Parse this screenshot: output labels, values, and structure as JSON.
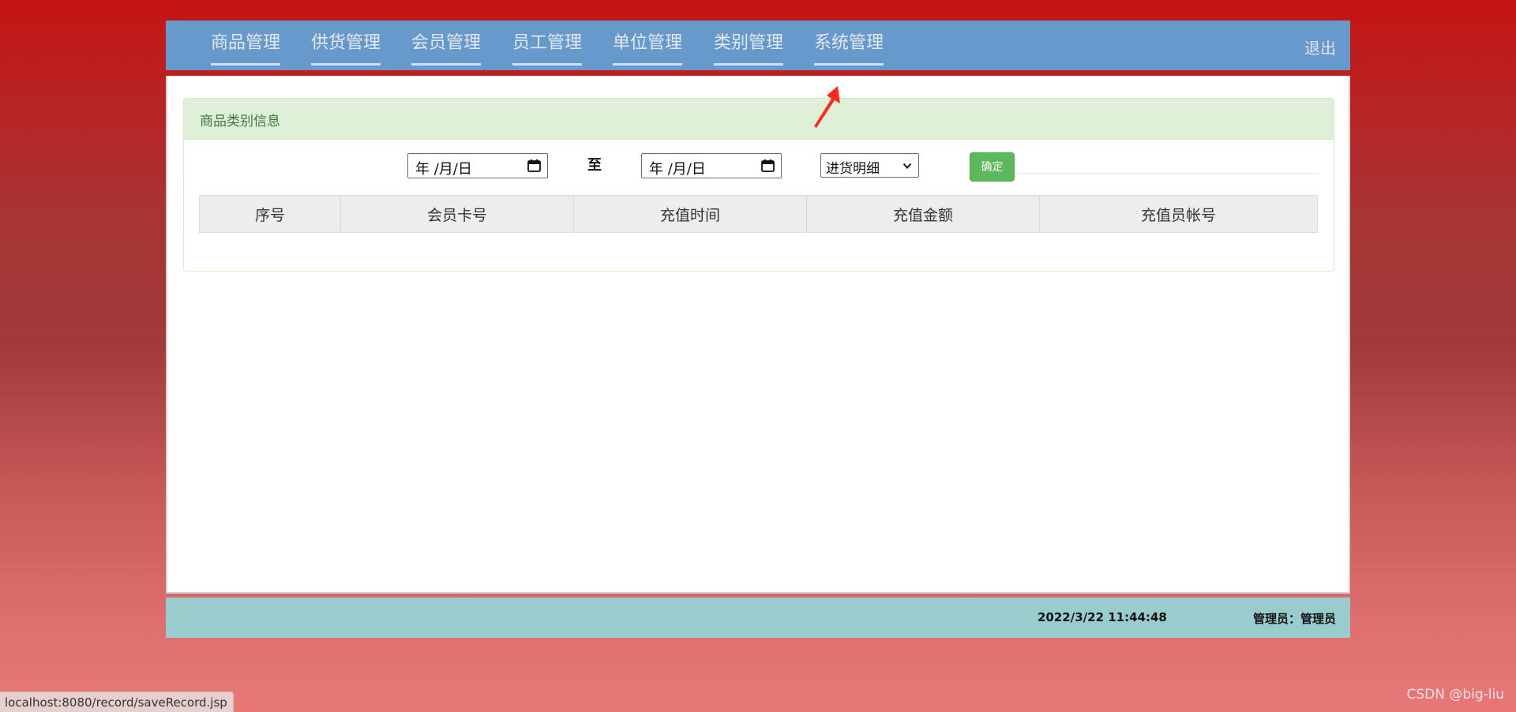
{
  "nav": {
    "items": [
      {
        "label": "商品管理"
      },
      {
        "label": "供货管理"
      },
      {
        "label": "会员管理"
      },
      {
        "label": "员工管理"
      },
      {
        "label": "单位管理"
      },
      {
        "label": "类别管理"
      },
      {
        "label": "系统管理"
      }
    ],
    "logout": "退出"
  },
  "panel": {
    "title": "商品类别信息"
  },
  "filters": {
    "start_date": "年 /月/日",
    "to_label": "至",
    "end_date": "年 /月/日",
    "select_value": "进货明细",
    "confirm_label": "确定"
  },
  "table": {
    "headers": [
      "序号",
      "会员卡号",
      "充值时间",
      "充值金额",
      "充值员帐号"
    ]
  },
  "footer": {
    "datetime": "2022/3/22 11:44:48",
    "user": "管理员：管理员"
  },
  "statusbar": {
    "url": "localhost:8080/record/saveRecord.jsp"
  },
  "watermark": {
    "text": "CSDN @big-liu"
  },
  "colors": {
    "nav_bg": "#6699cc",
    "panel_heading_bg": "#dff0d8",
    "confirm_bg": "#5cb85c",
    "footer_bg": "#99cccc",
    "page_bg_top": "#c61414",
    "page_bg_bottom": "#e87878",
    "annotation_arrow": "#ff2a1a"
  },
  "icons": {
    "date_picker": "calendar-icon",
    "select": "chevron-down-icon",
    "annotation": "red-arrow-icon"
  }
}
